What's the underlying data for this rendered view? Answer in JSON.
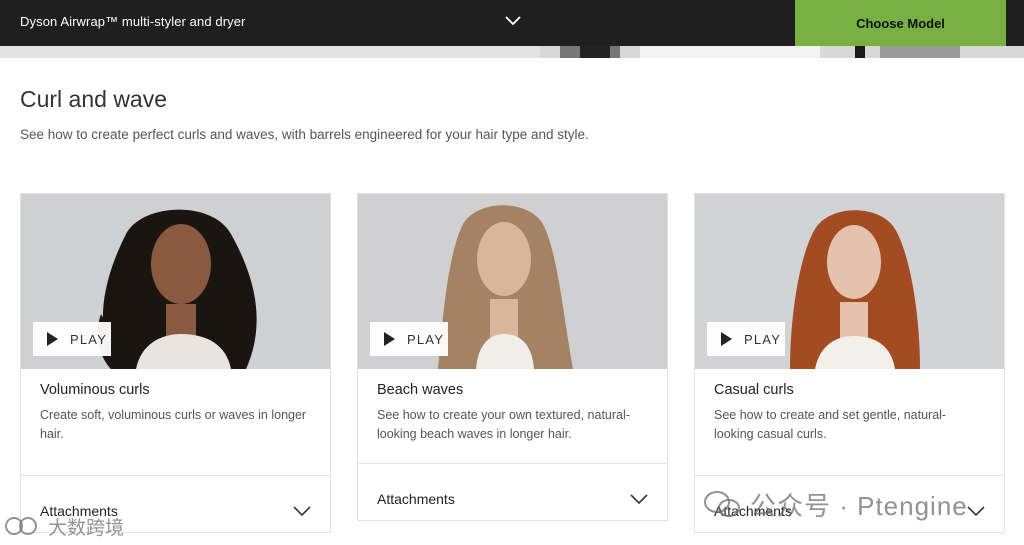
{
  "topbar": {
    "title": "Dyson Airwrap™ multi-styler and dryer",
    "choose_label": "Choose Model"
  },
  "section": {
    "title": "Curl and wave",
    "subtitle": "See how to create perfect curls and waves, with  barrels engineered for your hair type and style."
  },
  "cards": [
    {
      "play_label": "PLAY",
      "title": "Voluminous curls",
      "description": "Create soft, voluminous curls or waves in longer hair.",
      "attachments_label": "Attachments",
      "hair_color": "#1b1512",
      "skin_color": "#8a5a40"
    },
    {
      "play_label": "PLAY",
      "title": "Beach waves",
      "description": "See how to create your own textured, natural-looking beach waves in longer hair.",
      "attachments_label": "Attachments",
      "hair_color": "#a48364",
      "skin_color": "#d9b59a"
    },
    {
      "play_label": "PLAY",
      "title": "Casual curls",
      "description": "See how to create and set gentle, natural-looking casual curls.",
      "attachments_label": "Attachments",
      "hair_color": "#a34b22",
      "skin_color": "#e5c2ad"
    }
  ],
  "watermarks": {
    "right": "公众号 · Ptengine",
    "left": "大数跨境"
  },
  "colors": {
    "topbar_bg": "#1f1f1f",
    "accent_green": "#77b144",
    "card_border": "#e2e2e2"
  }
}
